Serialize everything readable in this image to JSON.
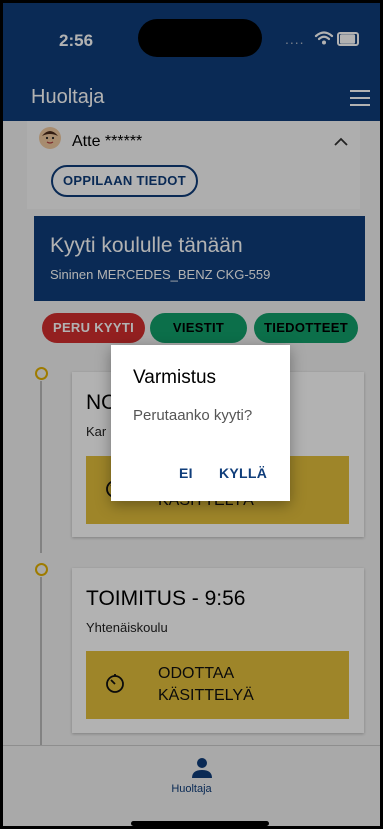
{
  "status_bar": {
    "time": "2:56",
    "signal": "....",
    "icons": [
      "wifi-icon",
      "battery-icon"
    ]
  },
  "app_bar": {
    "title": "Huoltaja",
    "menu_icon": "hamburger-menu-icon"
  },
  "student": {
    "name": "Atte ******",
    "avatar_icon": "child-avatar-icon",
    "expand_icon": "chevron-up-icon",
    "info_button": "OPPILAAN TIEDOT"
  },
  "ride": {
    "title": "Kyyti koululle tänään",
    "vehicle": "Sininen MERCEDES_BENZ CKG-559"
  },
  "actions": [
    {
      "label": "PERU KYYTI",
      "color": "#d32f2f"
    },
    {
      "label": "VIESTIT",
      "color": "#12a06b"
    },
    {
      "label": "TIEDOTTEET",
      "color": "#12a06b"
    }
  ],
  "stops": [
    {
      "title": "NOUTO",
      "place": "Kar",
      "state": "KÄSITTELYÄ",
      "state_icon": "timer-icon"
    },
    {
      "title": "TOIMITUS - 9:56",
      "place": "Yhtenäiskoulu",
      "state": "ODOTTAA KÄSITTELYÄ",
      "state_line1": "ODOTTAA",
      "state_line2": "KÄSITTELYÄ",
      "state_icon": "timer-icon"
    }
  ],
  "tab_bar": {
    "label": "Huoltaja",
    "icon": "person-icon"
  },
  "dialog": {
    "title": "Varmistus",
    "message": "Perutaanko kyyti?",
    "cancel": "EI",
    "confirm": "KYLLÄ"
  },
  "colors": {
    "primary": "#0f3d7a",
    "accent_yellow": "#e3bf3c",
    "danger": "#d32f2f",
    "success": "#12a06b",
    "timeline_dot": "#e2b100"
  }
}
